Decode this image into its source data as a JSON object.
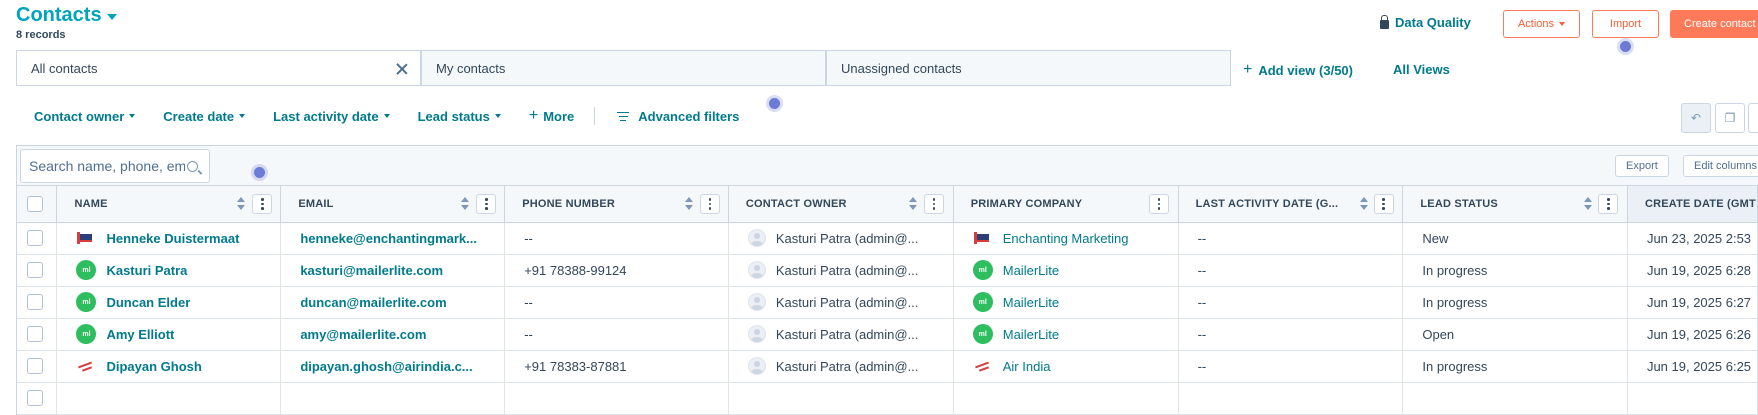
{
  "header": {
    "title": "Contacts",
    "record_count": "8 records",
    "data_quality_label": "Data Quality",
    "actions_label": "Actions",
    "import_label": "Import",
    "create_label": "Create contact"
  },
  "views": {
    "tabs": [
      {
        "label": "All contacts"
      },
      {
        "label": "My contacts"
      },
      {
        "label": "Unassigned contacts"
      }
    ],
    "add_view_label": "Add view (3/50)",
    "all_views_label": "All Views"
  },
  "filters": {
    "items": [
      "Contact owner",
      "Create date",
      "Last activity date",
      "Lead status"
    ],
    "more_label": "More",
    "advanced_label": "Advanced filters"
  },
  "table_toolbar": {
    "search_placeholder": "Search name, phone, email",
    "export_label": "Export",
    "edit_columns_label": "Edit columns"
  },
  "columns": [
    "NAME",
    "EMAIL",
    "PHONE NUMBER",
    "CONTACT OWNER",
    "PRIMARY COMPANY",
    "LAST ACTIVITY DATE (G...",
    "LEAD STATUS",
    "CREATE DATE (GMT"
  ],
  "rows": [
    {
      "name": "Henneke Duistermaat",
      "email": "henneke@enchantingmark...",
      "phone": "--",
      "owner": "Kasturi Patra (admin@...",
      "company": "Enchanting Marketing",
      "company_icon": "flag-logo-icon",
      "last_activity": "--",
      "lead_status": "New",
      "create_date": "Jun 23, 2025 2:53"
    },
    {
      "name": "Kasturi Patra",
      "email": "kasturi@mailerlite.com",
      "phone": "+91 78388-99124",
      "owner": "Kasturi Patra (admin@...",
      "company": "MailerLite",
      "company_icon": "mailerlite-logo-icon",
      "last_activity": "--",
      "lead_status": "In progress",
      "create_date": "Jun 19, 2025 6:28"
    },
    {
      "name": "Duncan Elder",
      "email": "duncan@mailerlite.com",
      "phone": "--",
      "owner": "Kasturi Patra (admin@...",
      "company": "MailerLite",
      "company_icon": "mailerlite-logo-icon",
      "last_activity": "--",
      "lead_status": "In progress",
      "create_date": "Jun 19, 2025 6:27"
    },
    {
      "name": "Amy Elliott",
      "email": "amy@mailerlite.com",
      "phone": "--",
      "owner": "Kasturi Patra (admin@...",
      "company": "MailerLite",
      "company_icon": "mailerlite-logo-icon",
      "last_activity": "--",
      "lead_status": "Open",
      "create_date": "Jun 19, 2025 6:26"
    },
    {
      "name": "Dipayan Ghosh",
      "email": "dipayan.ghosh@airindia.c...",
      "phone": "+91 78383-87881",
      "owner": "Kasturi Patra (admin@...",
      "company": "Air India",
      "company_icon": "airindia-logo-icon",
      "last_activity": "--",
      "lead_status": "In progress",
      "create_date": "Jun 19, 2025 6:25"
    }
  ],
  "colors": {
    "accent": "#00a4bd",
    "link": "#007a8c",
    "brand_orange": "#ff7a59",
    "mailerlite_green": "#2dbe60"
  }
}
